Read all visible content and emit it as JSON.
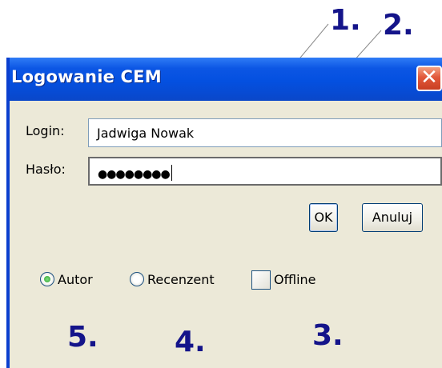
{
  "window": {
    "title": "Logowanie CEM",
    "close_icon": "close-icon"
  },
  "form": {
    "login_label": "Login:",
    "login_value": "Jadwiga Nowak",
    "password_label": "Hasło:",
    "password_masked": "●●●●●●●●"
  },
  "buttons": {
    "ok": "OK",
    "cancel": "Anuluj"
  },
  "options": {
    "role_selected": "Autor",
    "autor_label": "Autor",
    "recenzent_label": "Recenzent",
    "offline_label": "Offline",
    "offline_checked": false
  },
  "callouts": {
    "c1": "1.",
    "c2": "2.",
    "c3": "3.",
    "c4": "4.",
    "c5": "5."
  },
  "colors": {
    "titlebar": "#0450e0",
    "dialog_bg": "#ece9d8",
    "callout": "#14148a"
  }
}
